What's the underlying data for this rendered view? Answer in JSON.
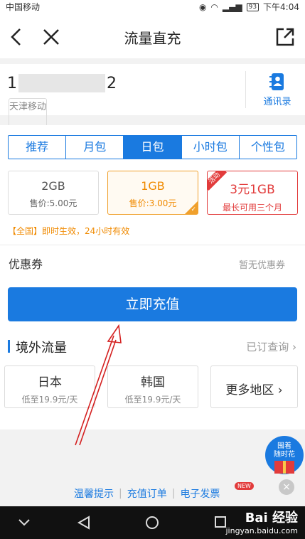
{
  "status_bar": {
    "carrier": "中国移动",
    "battery": "93",
    "time": "下午4:04"
  },
  "nav": {
    "title": "流量直充"
  },
  "phone": {
    "number_start": "1",
    "number_end": "2",
    "region": "天津移动",
    "contacts_label": "通讯录"
  },
  "tabs": [
    {
      "label": "推荐",
      "active": false
    },
    {
      "label": "月包",
      "active": false
    },
    {
      "label": "日包",
      "active": true
    },
    {
      "label": "小时包",
      "active": false
    },
    {
      "label": "个性包",
      "active": false
    }
  ],
  "packages": [
    {
      "name": "2GB",
      "price": "售价:5.00元",
      "state": "normal"
    },
    {
      "name": "1GB",
      "price": "售价:3.00元",
      "state": "selected"
    },
    {
      "name": "3元1GB",
      "price": "最长可用三个月",
      "state": "promo",
      "ribbon": "活动"
    }
  ],
  "notice": "【全国】即时生效，24小时有效",
  "coupon": {
    "label": "优惠券",
    "value": "暂无优惠券"
  },
  "recharge_button": "立即充值",
  "overseas": {
    "title": "境外流量",
    "query_link": "已订查询",
    "regions": [
      {
        "name": "日本",
        "price": "低至19.9元/天"
      },
      {
        "name": "韩国",
        "price": "低至19.9元/天"
      },
      {
        "name": "更多地区"
      }
    ]
  },
  "footer_links": [
    "温馨提示",
    "充值订单",
    "电子发票"
  ],
  "new_badge": "NEW",
  "float_badge": {
    "line1": "囤着",
    "line2": "随时花"
  },
  "watermark": {
    "brand": "Bai 经验",
    "url": "jingyan.baidu.com"
  }
}
